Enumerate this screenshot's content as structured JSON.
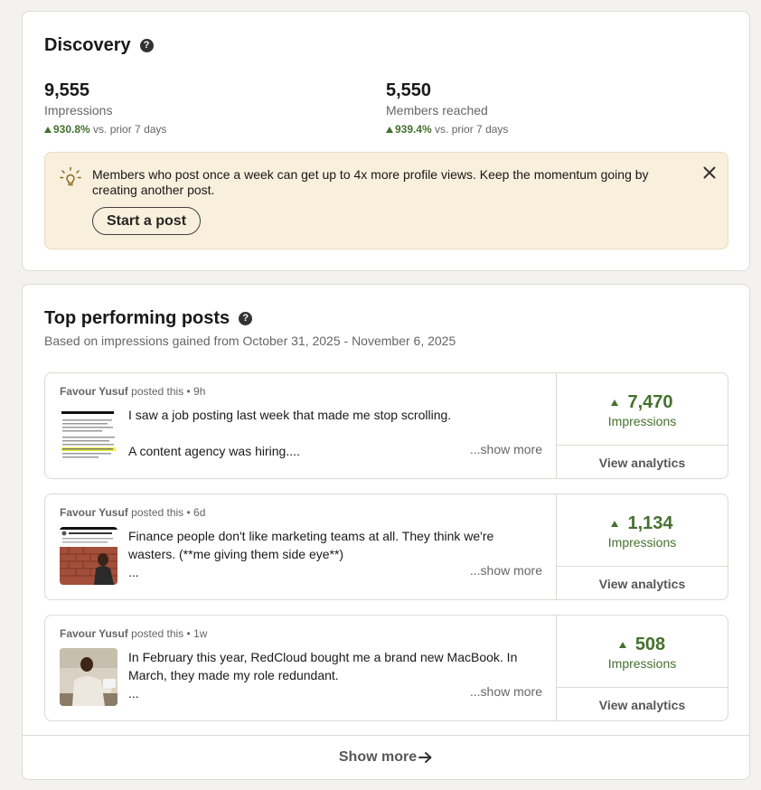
{
  "discovery": {
    "title": "Discovery",
    "help_icon": "question-circle-icon",
    "metrics": [
      {
        "value": "9,555",
        "label": "Impressions",
        "change": "930.8%",
        "change_suffix": "vs. prior 7 days"
      },
      {
        "value": "5,550",
        "label": "Members reached",
        "change": "939.4%",
        "change_suffix": "vs. prior 7 days"
      }
    ],
    "tip": {
      "icon": "lightbulb-icon",
      "text": "Members who post once a week can get up to 4x more profile views. Keep the momentum going by creating another post.",
      "button_label": "Start a post",
      "close_icon": "close-icon"
    }
  },
  "top_posts": {
    "title": "Top performing posts",
    "help_icon": "question-circle-icon",
    "subtitle": "Based on impressions gained from October 31, 2025 - November 6, 2025",
    "posts": [
      {
        "author": "Favour Yusuf",
        "meta_suffix": "posted this • 9h",
        "lines": [
          "I saw a job posting last week that made me stop scrolling.",
          "",
          "A content agency was hiring...."
        ],
        "show_more": "...show more",
        "impressions": "7,470",
        "impressions_label": "Impressions",
        "analytics_label": "View analytics"
      },
      {
        "author": "Favour Yusuf",
        "meta_suffix": "posted this • 6d",
        "lines": [
          "Finance people don't like marketing teams at all. They think we're",
          "wasters. (**me giving them side eye**)",
          "..."
        ],
        "show_more": "...show more",
        "impressions": "1,134",
        "impressions_label": "Impressions",
        "analytics_label": "View analytics"
      },
      {
        "author": "Favour Yusuf",
        "meta_suffix": "posted this • 1w",
        "lines": [
          "In February this year, RedCloud bought me a brand new MacBook. In",
          "March, they made my role redundant.",
          "..."
        ],
        "show_more": "...show more",
        "impressions": "508",
        "impressions_label": "Impressions",
        "analytics_label": "View analytics"
      }
    ],
    "show_more_label": "Show more"
  },
  "colors": {
    "accent_green": "#44712e",
    "tip_background": "#f8efdd",
    "page_background": "#f4f2ee"
  }
}
